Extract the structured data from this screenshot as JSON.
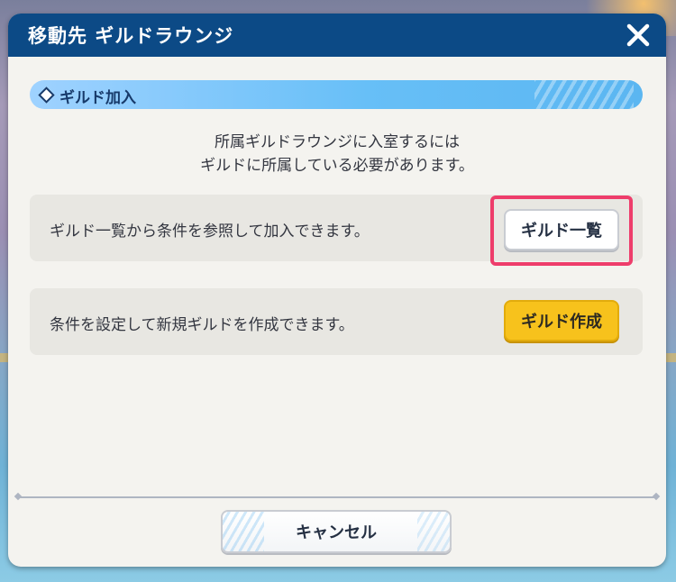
{
  "dialog": {
    "title": "移動先 ギルドラウンジ",
    "close_icon": "close-icon"
  },
  "section": {
    "label": "ギルド加入",
    "icon": "diamond-icon"
  },
  "info": {
    "line1": "所属ギルドラウンジに入室するには",
    "line2": "ギルドに所属している必要があります。"
  },
  "options": [
    {
      "text": "ギルド一覧から条件を参照して加入できます。",
      "button_label": "ギルド一覧"
    },
    {
      "text": "条件を設定して新規ギルドを作成できます。",
      "button_label": "ギルド作成"
    }
  ],
  "footer": {
    "cancel_label": "キャンセル"
  },
  "colors": {
    "header": "#0c4a86",
    "section_bar": "#67bff7",
    "highlight": "#ee3d6b",
    "create_button": "#f7c21c"
  }
}
